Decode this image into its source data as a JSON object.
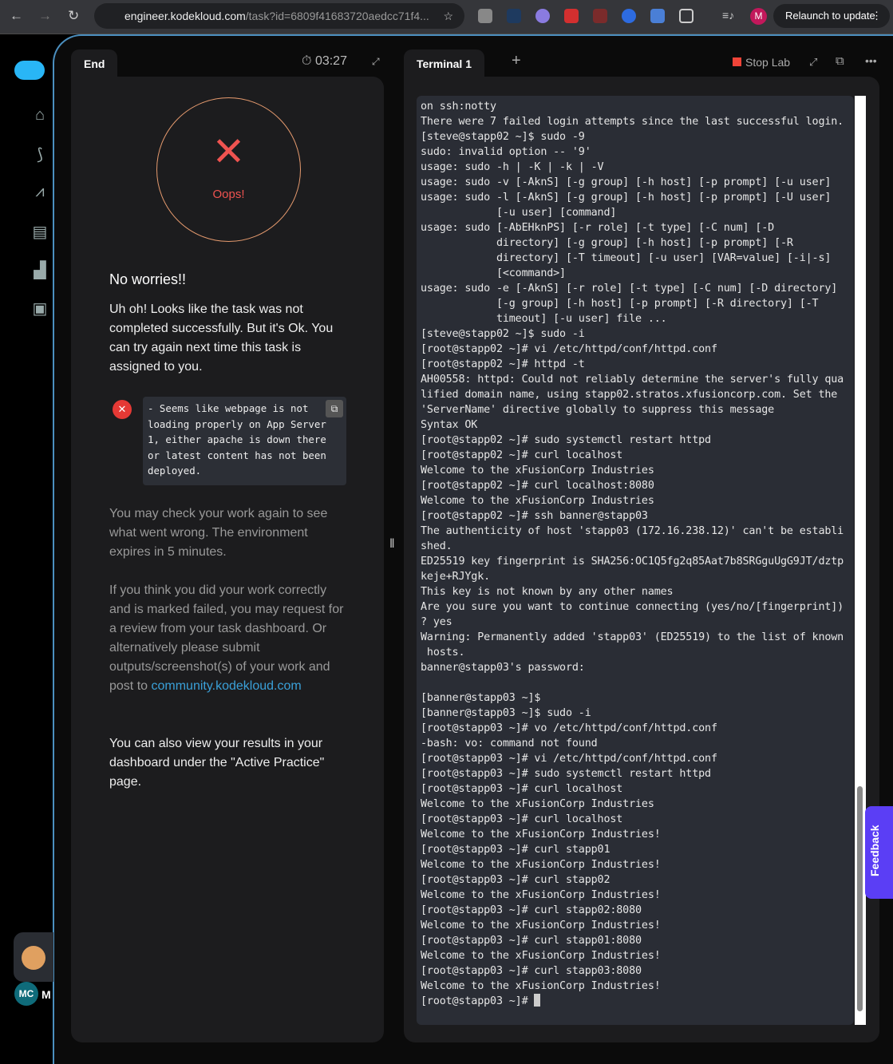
{
  "browser": {
    "url_host": "engineer.kodekloud.com",
    "url_path": "/task?id=6809f41683720aedcc71f4...",
    "relaunch": "Relaunch to update",
    "profile": "M",
    "ext_badge": "1"
  },
  "sidebar": {
    "items": [
      "home-icon",
      "roadmap-icon",
      "progress-icon",
      "courses-icon",
      "leaderboard-icon",
      "feedback-icon"
    ],
    "user_initials": "MC",
    "user_name_partial": "M"
  },
  "left": {
    "tab": "End",
    "timer": "03:27",
    "status": "Oops!",
    "heading": "No worries!!",
    "p1": "Uh oh! Looks like the task was not completed successfully. But it's Ok. You can try again next time this task is assigned to you.",
    "error": " - Seems like webpage is not loading properly on App Server 1, either apache is down there or latest content has not been deployed.",
    "p2": "You may check your work again to see what went wrong. The environment expires in 5 minutes.",
    "p3": "If you think you did your work correctly and is marked failed, you may request for a review from your task dashboard. Or alternatively please submit outputs/screenshot(s) of your work and post to ",
    "p3_link": "community.kodekloud.com",
    "p4": "You can also view your results in your dashboard under the \"Active Practice\" page."
  },
  "terminal": {
    "tab": "Terminal 1",
    "add": "+",
    "stop": "Stop Lab",
    "feedback": "Feedback",
    "lines": [
      "on ssh:notty",
      "There were 7 failed login attempts since the last successful login.",
      "[steve@stapp02 ~]$ sudo -9",
      "sudo: invalid option -- '9'",
      "usage: sudo -h | -K | -k | -V",
      "usage: sudo -v [-AknS] [-g group] [-h host] [-p prompt] [-u user]",
      "usage: sudo -l [-AknS] [-g group] [-h host] [-p prompt] [-U user]",
      "            [-u user] [command]",
      "usage: sudo [-AbEHknPS] [-r role] [-t type] [-C num] [-D",
      "            directory] [-g group] [-h host] [-p prompt] [-R",
      "            directory] [-T timeout] [-u user] [VAR=value] [-i|-s]",
      "            [<command>]",
      "usage: sudo -e [-AknS] [-r role] [-t type] [-C num] [-D directory]",
      "            [-g group] [-h host] [-p prompt] [-R directory] [-T",
      "            timeout] [-u user] file ...",
      "[steve@stapp02 ~]$ sudo -i",
      "[root@stapp02 ~]# vi /etc/httpd/conf/httpd.conf",
      "[root@stapp02 ~]# httpd -t",
      "AH00558: httpd: Could not reliably determine the server's fully qua",
      "lified domain name, using stapp02.stratos.xfusioncorp.com. Set the",
      "'ServerName' directive globally to suppress this message",
      "Syntax OK",
      "[root@stapp02 ~]# sudo systemctl restart httpd",
      "[root@stapp02 ~]# curl localhost",
      "Welcome to the xFusionCorp Industries",
      "[root@stapp02 ~]# curl localhost:8080",
      "Welcome to the xFusionCorp Industries",
      "[root@stapp02 ~]# ssh banner@stapp03",
      "The authenticity of host 'stapp03 (172.16.238.12)' can't be establi",
      "shed.",
      "ED25519 key fingerprint is SHA256:OC1Q5fg2q85Aat7b8SRGguUgG9JT/dztp",
      "keje+RJYgk.",
      "This key is not known by any other names",
      "Are you sure you want to continue connecting (yes/no/[fingerprint])",
      "? yes",
      "Warning: Permanently added 'stapp03' (ED25519) to the list of known",
      " hosts.",
      "banner@stapp03's password:",
      "",
      "[banner@stapp03 ~]$",
      "[banner@stapp03 ~]$ sudo -i",
      "[root@stapp03 ~]# vo /etc/httpd/conf/httpd.conf",
      "-bash: vo: command not found",
      "[root@stapp03 ~]# vi /etc/httpd/conf/httpd.conf",
      "[root@stapp03 ~]# sudo systemctl restart httpd",
      "[root@stapp03 ~]# curl localhost",
      "Welcome to the xFusionCorp Industries",
      "[root@stapp03 ~]# curl localhost",
      "Welcome to the xFusionCorp Industries!",
      "[root@stapp03 ~]# curl stapp01",
      "Welcome to the xFusionCorp Industries!",
      "[root@stapp03 ~]# curl stapp02",
      "Welcome to the xFusionCorp Industries!",
      "[root@stapp03 ~]# curl stapp02:8080",
      "Welcome to the xFusionCorp Industries!",
      "[root@stapp03 ~]# curl stapp01:8080",
      "Welcome to the xFusionCorp Industries!",
      "[root@stapp03 ~]# curl stapp03:8080",
      "Welcome to the xFusionCorp Industries!"
    ],
    "prompt": "[root@stapp03 ~]# "
  },
  "colors": {
    "accent": "#4b8fbf",
    "error": "#ef5350",
    "link": "#3aa0d8",
    "stop": "#f04438",
    "feedback": "#5b3ef5"
  }
}
